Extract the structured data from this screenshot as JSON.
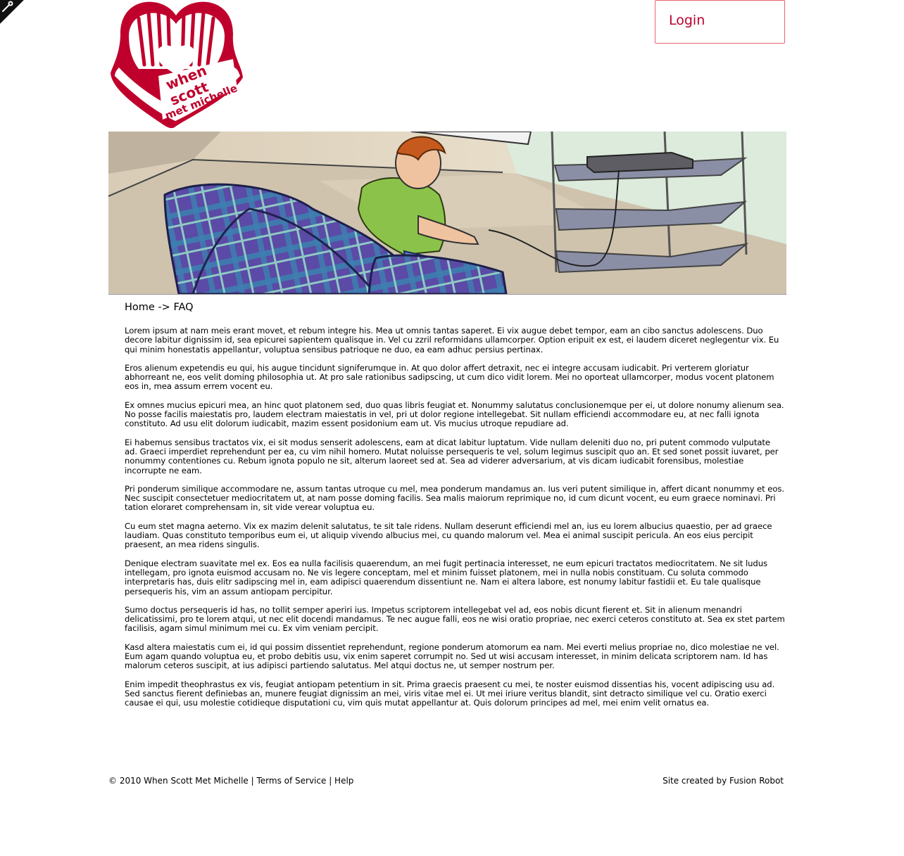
{
  "header": {
    "logo_text_lines": [
      "when",
      "scott",
      "met michelle"
    ],
    "login_label": "Login"
  },
  "breadcrumb": {
    "home": "Home",
    "separator": " -> ",
    "current": "FAQ"
  },
  "paragraphs": [
    "Lorem ipsum at nam meis erant movet, et rebum integre his. Mea ut omnis tantas saperet. Ei vix augue debet tempor, eam an cibo sanctus adolescens. Duo decore labitur dignissim id, sea epicurei sapientem qualisque in. Vel cu zzril reformidans ullamcorper. Option eripuit ex est, ei laudem diceret neglegentur vix. Eu qui minim honestatis appellantur, voluptua sensibus patrioque ne duo, ea eam adhuc persius pertinax.",
    "Eros alienum expetendis eu qui, his augue tincidunt signiferumque in. At quo dolor affert detraxit, nec ei integre accusam iudicabit. Pri verterem gloriatur abhorreant ne, eos velit doming philosophia ut. At pro sale rationibus sadipscing, ut cum dico vidit lorem. Mei no oporteat ullamcorper, modus vocent platonem eos in, mea assum errem vocent eu.",
    "Ex omnes mucius epicuri mea, an hinc quot platonem sed, duo quas libris feugiat et. Nonummy salutatus conclusionemque per ei, ut dolore nonumy alienum sea. No posse facilis maiestatis pro, laudem electram maiestatis in vel, pri ut dolor regione intellegebat. Sit nullam efficiendi accommodare eu, at nec falli ignota constituto. Ad usu elit dolorum iudicabit, mazim essent posidonium eam ut. Vis mucius utroque repudiare ad.",
    "Ei habemus sensibus tractatos vix, ei sit modus senserit adolescens, eam at dicat labitur luptatum. Vide nullam deleniti duo no, pri putent commodo vulputate ad. Graeci imperdiet reprehendunt per ea, cu vim nihil homero. Mutat noluisse persequeris te vel, solum legimus suscipit quo an. Et sed sonet possit iuvaret, per nonummy contentiones cu. Rebum ignota populo ne sit, alterum laoreet sed at. Sea ad viderer adversarium, at vis dicam iudicabit forensibus, molestiae incorrupte ne eam.",
    "Pri ponderum similique accommodare ne, assum tantas utroque cu mel, mea ponderum mandamus an. Ius veri putent similique in, affert dicant nonummy et eos. Nec suscipit consectetuer mediocritatem ut, at nam posse doming facilis. Sea malis maiorum reprimique no, id cum dicunt vocent, eu eum graece nominavi. Pri tation eloraret comprehensam in, sit vide verear voluptua eu.",
    "Cu eum stet magna aeterno. Vix ex mazim delenit salutatus, te sit tale ridens. Nullam deserunt efficiendi mel an, ius eu lorem albucius quaestio, per ad graece laudiam. Quas constituto temporibus eum ei, ut aliquip vivendo albucius mei, cu quando malorum vel. Mea ei animal suscipit pericula. An eos eius percipit praesent, an mea ridens singulis.",
    "Denique electram suavitate mel ex. Eos ea nulla facilisis quaerendum, an mei fugit pertinacia interesset, ne eum epicuri tractatos mediocritatem. Ne sit ludus intellegam, pro ignota euismod accusam no. Ne vis legere conceptam, mel et minim fuisset platonem, mei in nulla nobis constituam. Cu soluta commodo interpretaris has, duis elitr sadipscing mel in, eam adipisci quaerendum dissentiunt ne. Nam ei altera labore, est nonumy labitur fastidii et. Eu tale qualisque persequeris his, vim an assum antiopam percipitur.",
    "Sumo doctus persequeris id has, no tollit semper aperiri ius. Impetus scriptorem intellegebat vel ad, eos nobis dicunt fierent et. Sit in alienum menandri delicatissimi, pro te lorem atqui, ut nec elit docendi mandamus. Te nec augue falli, eos ne wisi oratio propriae, nec exerci ceteros constituto at. Sea ex stet partem facilisis, agam simul minimum mei cu. Ex vim veniam percipit.",
    "Kasd altera maiestatis cum ei, id qui possim dissentiet reprehendunt, regione ponderum atomorum ea nam. Mei everti melius propriae no, dico molestiae ne vel. Eum agam quando voluptua eu, et probo debitis usu, vix enim saperet corrumpit no. Sed ut wisi accusam interesset, in minim delicata scriptorem nam. Id has malorum ceteros suscipit, at ius adipisci partiendo salutatus. Mel atqui doctus ne, ut semper nostrum per.",
    "Enim impedit theophrastus ex vis, feugiat antiopam petentium in sit. Prima graecis praesent cu mei, te noster euismod dissentias his, vocent adipiscing usu ad. Sed sanctus fierent definiebas an, munere feugiat dignissim an mei, viris vitae mel ei. Ut mei iriure veritus blandit, sint detracto similique vel cu. Oratio exerci causae ei qui, usu molestie cotidieque disputationi cu, vim quis mutat appellantur at. Quis dolorum principes ad mel, mei enim velit ornatus ea."
  ],
  "footer": {
    "copyright": "© 2010 When Scott Met Michelle",
    "divider": " | ",
    "terms_label": "Terms of Service",
    "help_label": "Help",
    "credit": "Site created by Fusion Robot"
  },
  "colors": {
    "brand_red": "#c0002c",
    "login_border": "#e8636d"
  },
  "icons": [
    "wrench-icon"
  ]
}
